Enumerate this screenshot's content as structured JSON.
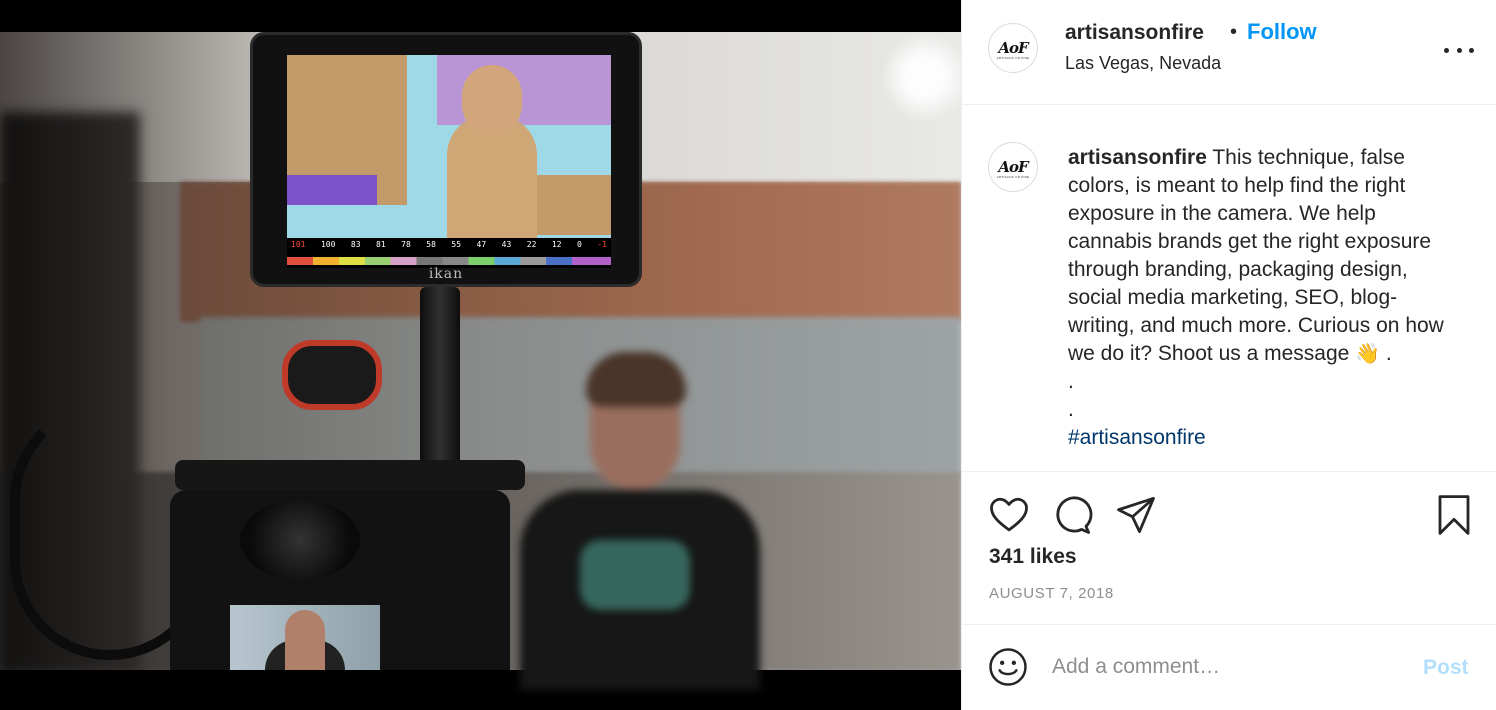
{
  "post": {
    "image_alt": "Camera rig with external monitor showing false color exposure",
    "monitor_brand": "ikan",
    "false_color_scale": [
      "101",
      "100",
      "83",
      "81",
      "78",
      "58",
      "55",
      "47",
      "43",
      "22",
      "12",
      "0",
      "-1"
    ]
  },
  "header": {
    "username": "artisansonfire",
    "separator": "•",
    "follow_label": "Follow",
    "location": "Las Vegas, Nevada",
    "avatar_mark": "AoF",
    "avatar_sub": "ARTISANS ON FIRE"
  },
  "caption": {
    "username": "artisansonfire",
    "text": " This technique, false colors, is meant to help find the right exposure in the camera. We help cannabis brands get the right exposure through branding, packaging design, social media marketing, SEO, blog-writing, and much more. Curious on how we do it? Shoot us a message ",
    "emoji": "👋",
    "after_emoji": " .",
    "dot1": ".",
    "dot2": ".",
    "hashtag": "#artisansonfire"
  },
  "actions": {
    "like_icon": "heart-icon",
    "comment_icon": "comment-icon",
    "share_icon": "share-icon",
    "save_icon": "bookmark-icon"
  },
  "likes": "341 likes",
  "date": "AUGUST 7, 2018",
  "comment_box": {
    "placeholder": "Add a comment…",
    "post_label": "Post",
    "emoji_icon": "smiley-icon"
  },
  "colors": {
    "follow": "#0095f6",
    "post_disabled": "#b2dffc",
    "text": "#262626",
    "muted": "#8e8e8e"
  }
}
